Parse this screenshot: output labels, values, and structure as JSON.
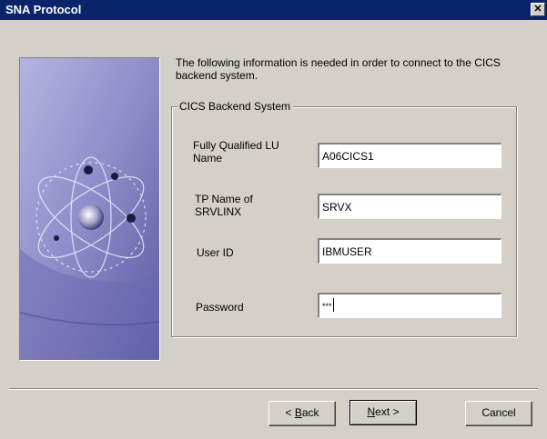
{
  "window": {
    "title": "SNA Protocol",
    "close_glyph": "✕"
  },
  "intro": {
    "text": "The following information is needed in order to connect to the CICS backend system."
  },
  "group": {
    "legend": "CICS Backend System"
  },
  "fields": {
    "lu_name": {
      "label": "Fully Qualified LU Name",
      "value": "A06CICS1"
    },
    "tp_name": {
      "label": "TP Name of SRVLINX",
      "value": "SRVX"
    },
    "user_id": {
      "label": "User ID",
      "value": "IBMUSER"
    },
    "password": {
      "label": "Password",
      "value": "***"
    }
  },
  "buttons": {
    "back": {
      "prefix": "< ",
      "mnemonic": "B",
      "rest": "ack"
    },
    "next": {
      "mnemonic": "N",
      "rest": "ext >"
    },
    "cancel": "Cancel"
  },
  "colors": {
    "titlebar": "#0a246a",
    "dialog_bg": "#d4d0c8",
    "image_bg": "#8a8ac6"
  }
}
